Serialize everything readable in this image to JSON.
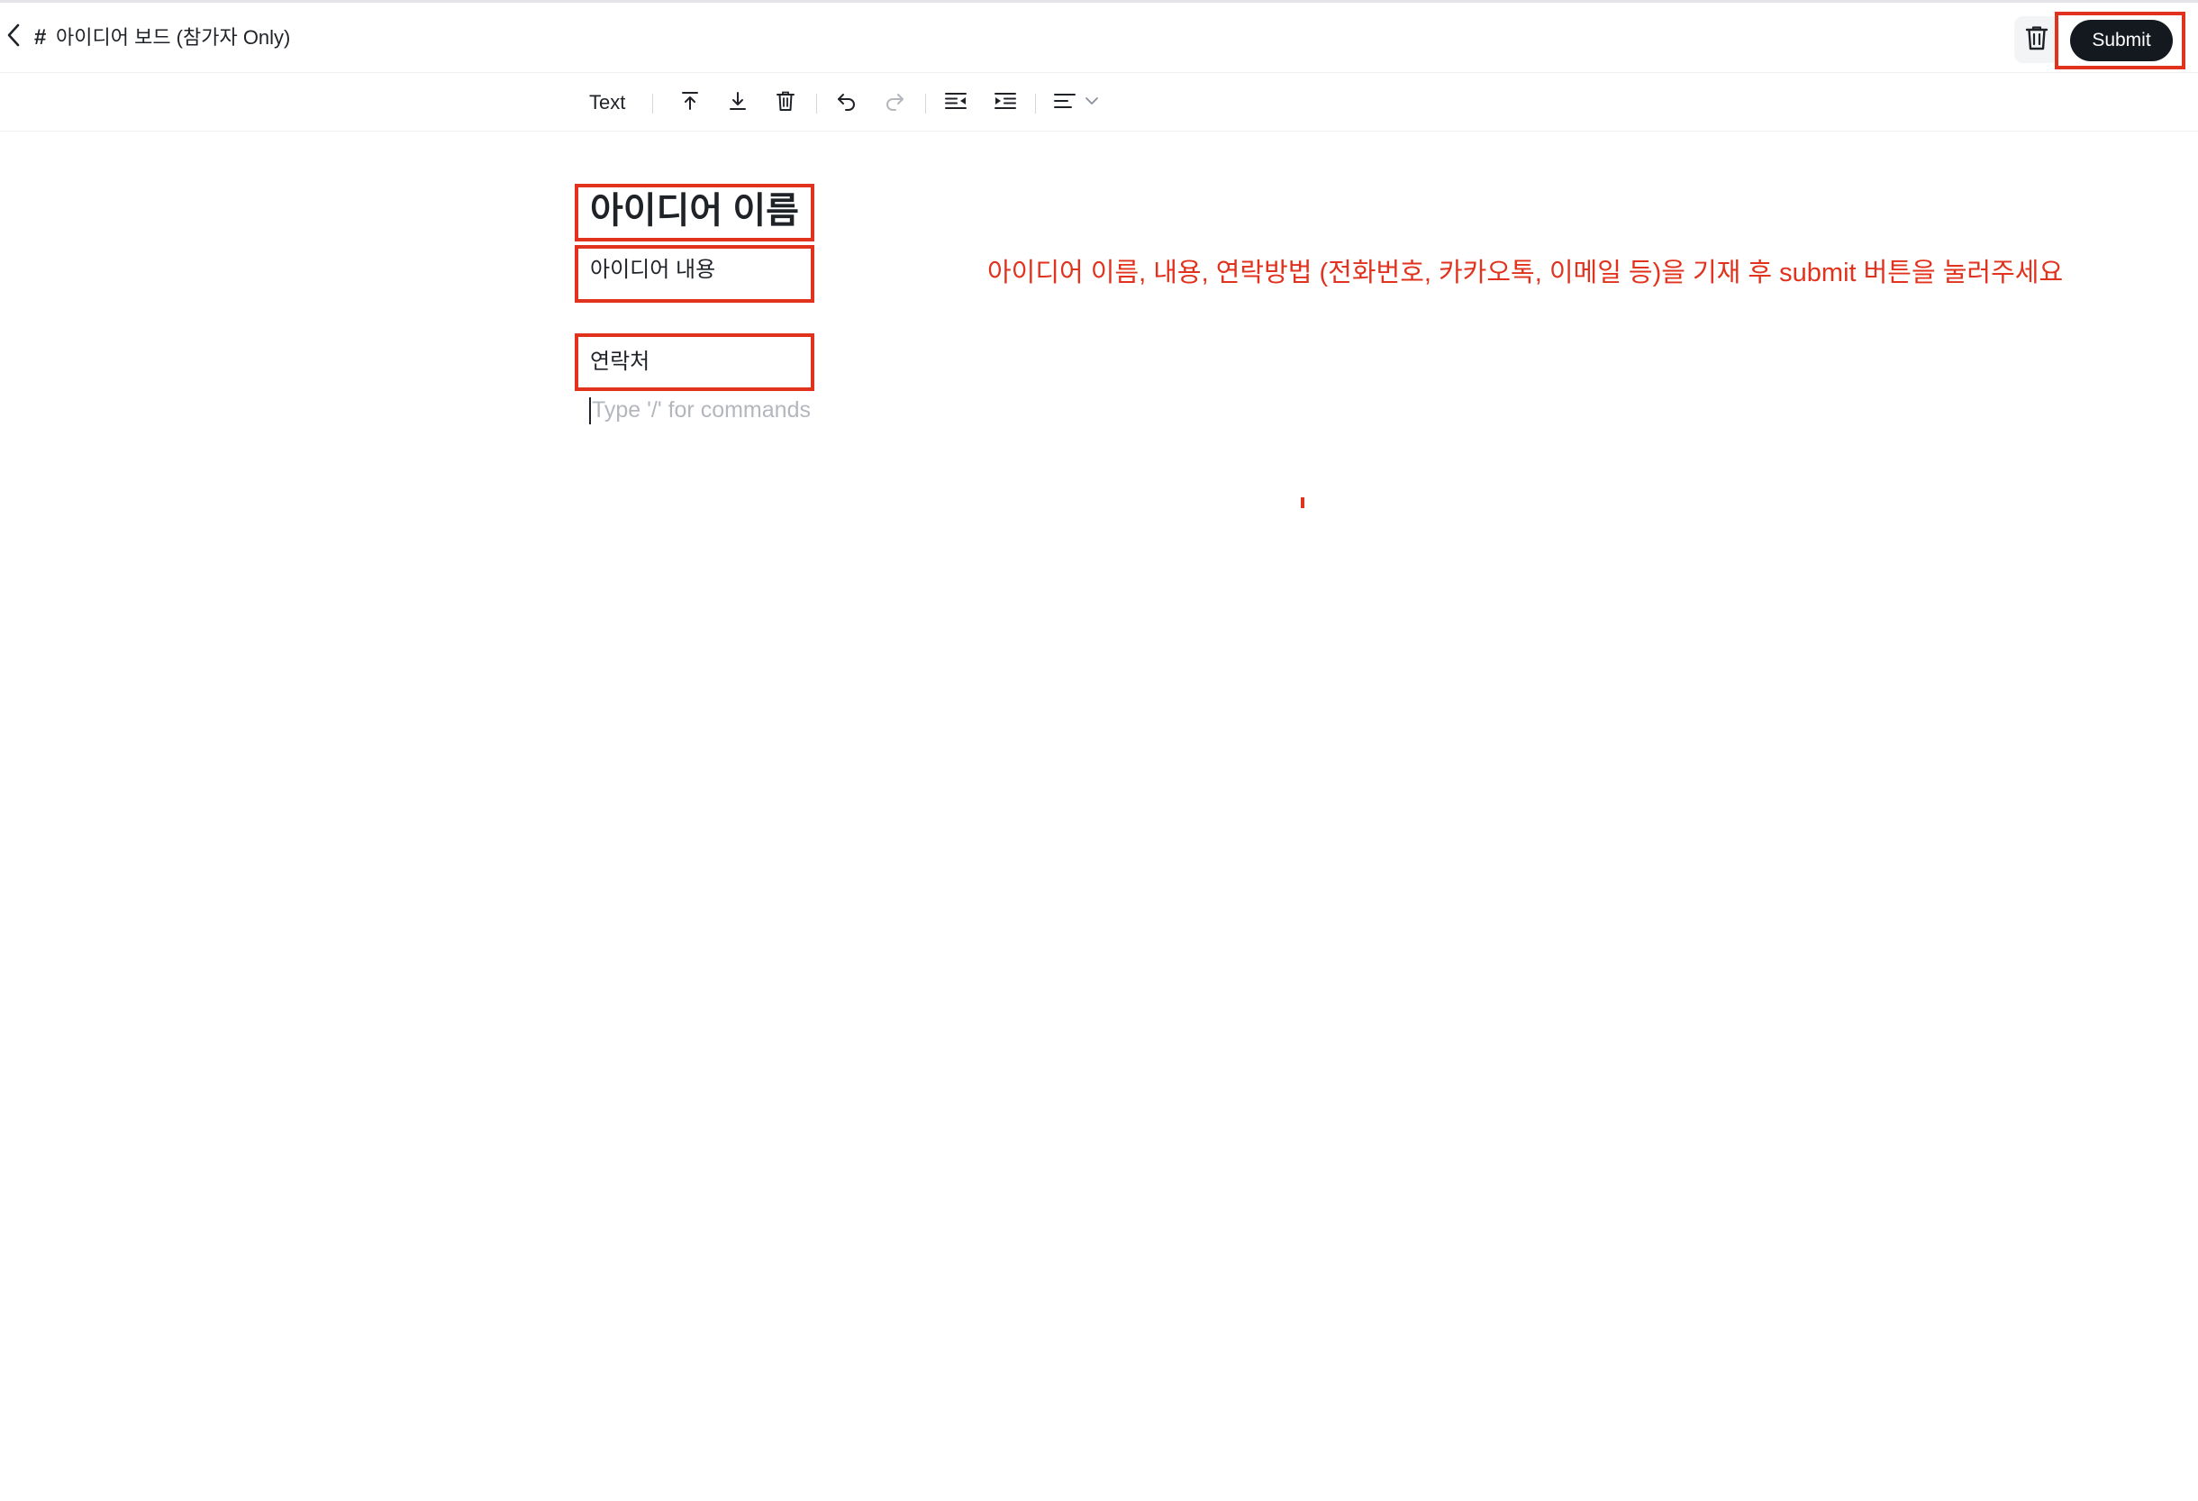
{
  "header": {
    "back_icon": "chevron-left-icon",
    "hash_symbol": "#",
    "channel_title": "아이디어 보드 (참가자 Only)",
    "trash_icon": "trash-icon",
    "submit_label": "Submit"
  },
  "toolbar": {
    "block_type_label": "Text",
    "icons": [
      "move-up-icon",
      "move-down-icon",
      "delete-block-icon",
      "undo-icon",
      "redo-icon",
      "outdent-icon",
      "indent-icon",
      "align-left-icon",
      "chevron-down-icon"
    ]
  },
  "editor": {
    "title_block": "아이디어 이름",
    "body_block": "아이디어 내용",
    "contact_block": "연락처",
    "empty_block_placeholder": "Type '/' for commands"
  },
  "annotation": {
    "instruction_text": "아이디어 이름, 내용, 연락방법 (전화번호, 카카오톡, 이메일 등)을 기재 후 submit 버튼을 눌러주세요"
  },
  "colors": {
    "highlight": "#e0321d",
    "submit_bg": "#14191f",
    "text": "#1f2328",
    "placeholder": "#b3b7bd"
  }
}
